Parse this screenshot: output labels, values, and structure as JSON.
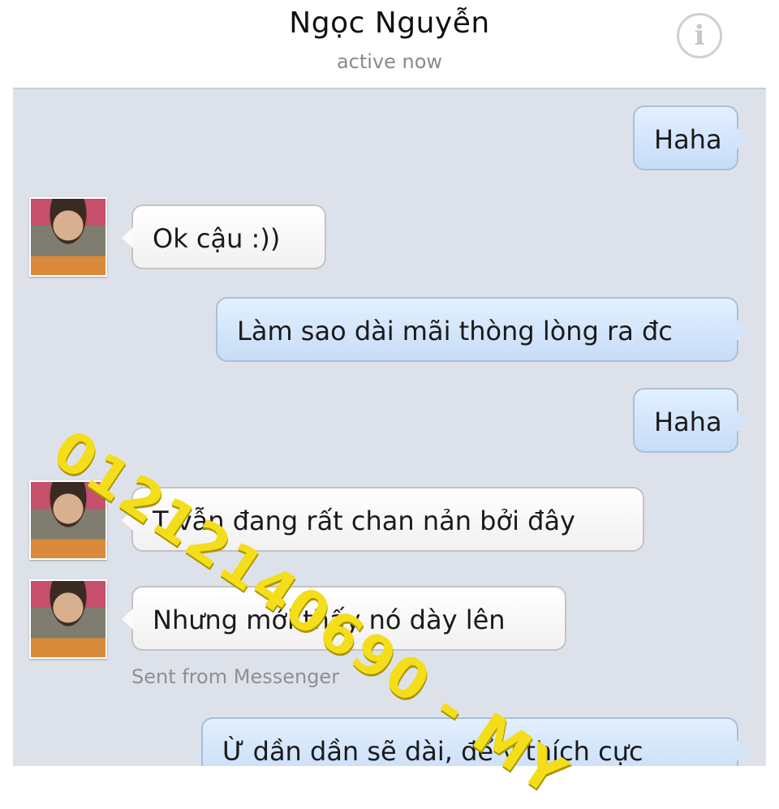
{
  "header": {
    "contact_name": "Ngọc Nguyễn",
    "status": "active now",
    "info_icon": "info-circle-icon",
    "info_glyph": "i"
  },
  "messages": [
    {
      "direction": "outgoing",
      "text": "Haha"
    },
    {
      "direction": "incoming",
      "text": "Ok cậu :))"
    },
    {
      "direction": "outgoing",
      "text": "Làm sao dài mãi thòng lòng ra đc"
    },
    {
      "direction": "outgoing",
      "text": "Haha"
    },
    {
      "direction": "incoming",
      "text": "T vẫn đang rất chan nản bởi đây"
    },
    {
      "direction": "incoming",
      "text": "Nhưng mới thấy nó dày lên"
    },
    {
      "direction": "outgoing",
      "text": "Ừ dần dần sẽ dài, để ý thích cực"
    }
  ],
  "sent_from": "Sent from Messenger",
  "watermark": "01212140690 - MY",
  "colors": {
    "outgoing_bubble": "#c7dcf7",
    "incoming_bubble": "#ffffff",
    "thread_background": "#dde2ea",
    "watermark": "#f4dd1a"
  }
}
